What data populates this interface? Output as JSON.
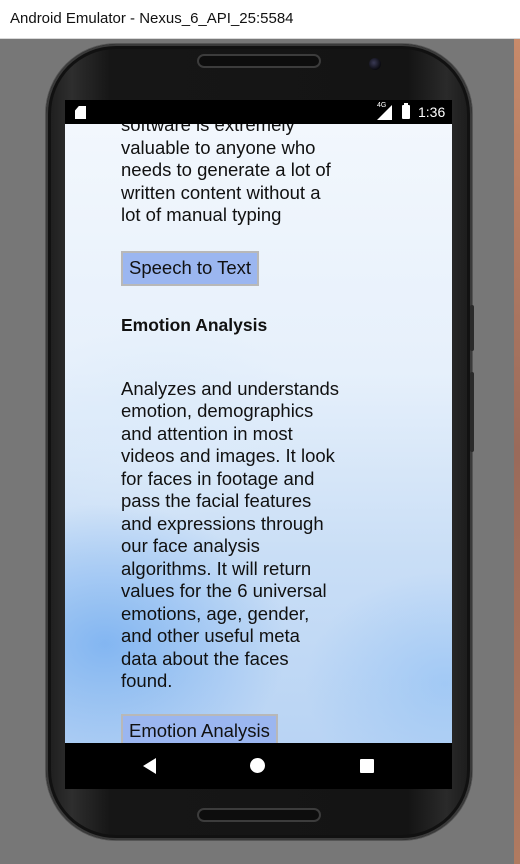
{
  "window": {
    "title": "Android Emulator - Nexus_6_API_25:5584"
  },
  "status_bar": {
    "network": "4G",
    "time": "1:36",
    "icons": [
      "sd-card-icon",
      "signal-icon",
      "battery-icon"
    ]
  },
  "content": {
    "top_paragraph": "software is extremely\nvaluable to anyone who\nneeds to generate a lot of\nwritten content without a\nlot of manual typing",
    "speech_button_label": "Speech to Text",
    "emotion_title": "Emotion Analysis",
    "emotion_paragraph": "Analyzes and understands\nemotion, demographics\nand attention in most\nvideos and images. It look\nfor faces in footage and\npass the facial features\nand expressions through\nour face analysis\nalgorithms. It will return\nvalues for the 6 universal\nemotions, age, gender,\nand other useful meta\ndata about the faces\nfound.",
    "emotion_button_label": "Emotion Analysis"
  },
  "nav_bar": {
    "icons": [
      "back-icon",
      "home-icon",
      "recents-icon"
    ]
  },
  "colors": {
    "button_bg": "#9bb6f0",
    "phone_body": "#161616",
    "screen_bg_top": "#f2f7fd",
    "screen_bg_bottom": "#b9d4f4"
  }
}
